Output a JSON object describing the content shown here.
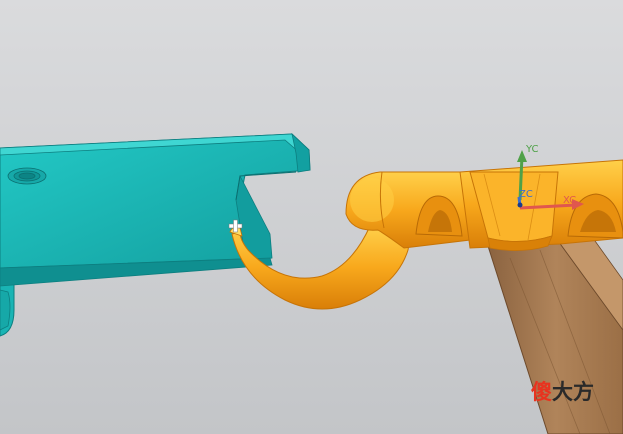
{
  "viewport": {
    "background_top": "#dadbdd",
    "background_bottom": "#c3c5c8"
  },
  "parts": {
    "bracket": {
      "color": "#1bbcbc"
    },
    "hook_arm": {
      "color": "#f8a81c"
    },
    "support_bar": {
      "color": "#a97a4e"
    }
  },
  "csys": {
    "x_label": "XC",
    "y_label": "YC",
    "z_label": "ZC",
    "x_color": "#e0574e",
    "y_color": "#4fa148",
    "z_color": "#3a6fd0"
  },
  "watermark": {
    "char_1": "傻",
    "char_2": "大方"
  }
}
